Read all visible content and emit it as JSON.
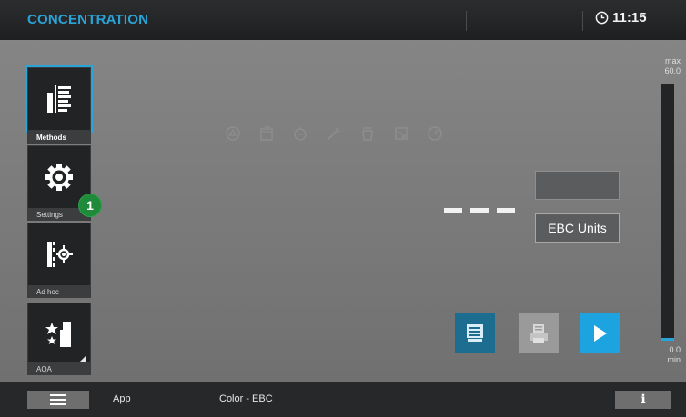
{
  "header": {
    "title": "CONCENTRATION",
    "time": "11:15"
  },
  "sidebar": {
    "items": [
      {
        "label": "Methods",
        "icon": "methods-icon",
        "active": true
      },
      {
        "label": "Settings",
        "icon": "gear-icon"
      },
      {
        "label": "Ad hoc",
        "icon": "ad-hoc-icon"
      },
      {
        "label": "AQA",
        "icon": "aqa-icon"
      }
    ]
  },
  "annotation": {
    "marker": "1"
  },
  "measurement": {
    "reading": "---",
    "units": "EBC Units"
  },
  "scale": {
    "max_label": "max",
    "max_value": "60.0",
    "min_value": "0.0",
    "min_label": "min"
  },
  "status_bar": {
    "app": "App",
    "method": "Color - EBC",
    "info": "i"
  },
  "colors": {
    "accent": "#2aa4d8",
    "badge": "#1f8a3a",
    "play": "#1da4e0"
  }
}
